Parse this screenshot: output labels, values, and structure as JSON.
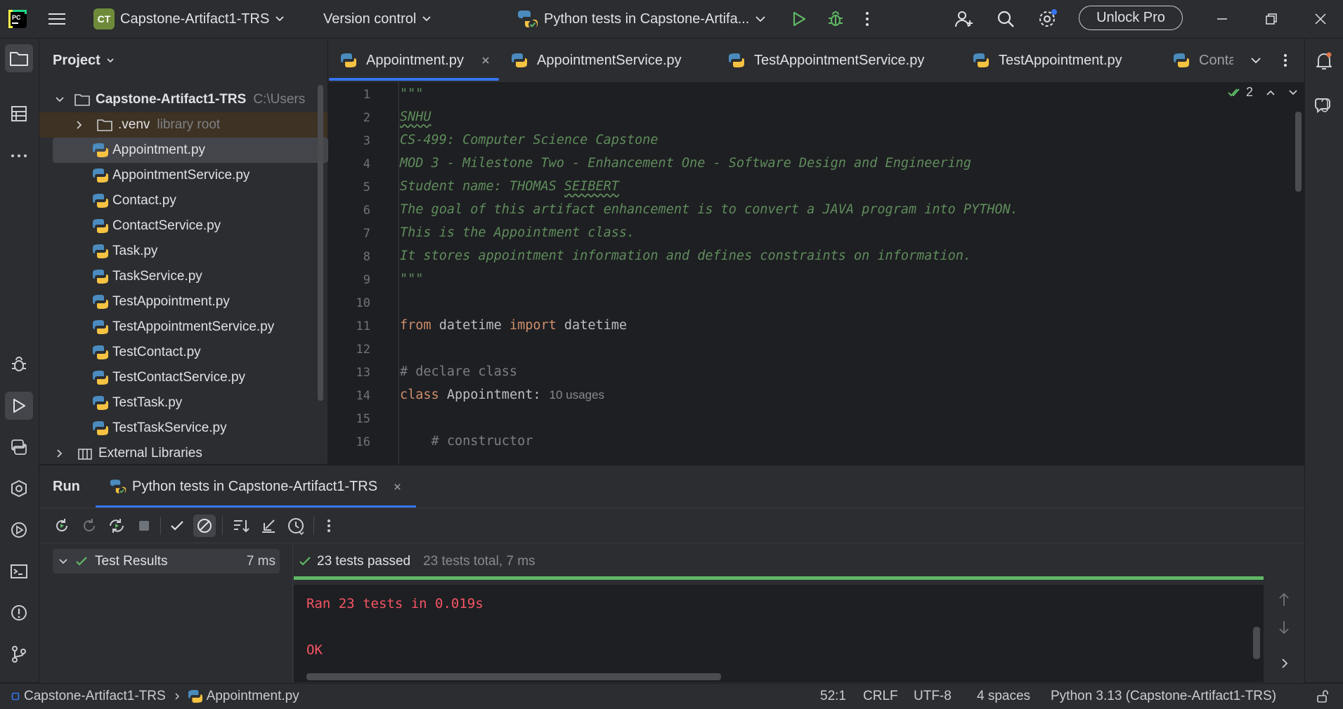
{
  "titlebar": {
    "project_badge": "CT",
    "project_name": "Capstone-Artifact1-TRS",
    "version_control": "Version control",
    "run_config": "Python tests in Capstone-Artifa...",
    "unlock_pro": "Unlock Pro"
  },
  "project_panel": {
    "title": "Project",
    "root_name": "Capstone-Artifact1-TRS",
    "root_path": "C:\\Users",
    "venv_name": ".venv",
    "venv_hint": "library root",
    "files": [
      "Appointment.py",
      "AppointmentService.py",
      "Contact.py",
      "ContactService.py",
      "Task.py",
      "TaskService.py",
      "TestAppointment.py",
      "TestAppointmentService.py",
      "TestContact.py",
      "TestContactService.py",
      "TestTask.py",
      "TestTaskService.py"
    ],
    "external_libraries": "External Libraries"
  },
  "editor_tabs": [
    "Appointment.py",
    "AppointmentService.py",
    "TestAppointmentService.py",
    "TestAppointment.py",
    "Conta"
  ],
  "editor": {
    "inspection_count": "2",
    "line_numbers": [
      "1",
      "2",
      "3",
      "4",
      "5",
      "6",
      "7",
      "8",
      "9",
      "10",
      "11",
      "12",
      "13",
      "14",
      "15",
      "16"
    ],
    "docstring_open": "\"\"\"",
    "doc_snhu": "SNHU",
    "doc_line3": "CS-499: Computer Science Capstone",
    "doc_line4": "MOD 3 - Milestone Two - Enhancement One - Software Design and Engineering",
    "doc_line5_prefix": "Student name: THOMAS ",
    "doc_line5_name": "SEIBERT",
    "doc_line6": "The goal of this artifact enhancement is to convert a JAVA program into PYTHON.",
    "doc_line7": "This is the Appointment class.",
    "doc_line8": "It stores appointment information and defines constraints on information.",
    "docstring_close": "\"\"\"",
    "kw_from": "from",
    "mod_datetime": " datetime ",
    "kw_import": "import",
    "name_datetime": " datetime",
    "comment_declare": "# declare class",
    "kw_class": "class",
    "class_decl": " Appointment:",
    "usages": "10 usages",
    "comment_constructor": "    # constructor"
  },
  "run_panel": {
    "title": "Run",
    "tab_label": "Python tests in Capstone-Artifact1-TRS",
    "test_results_label": "Test Results",
    "test_results_time": "7 ms",
    "passed_text": "23 tests passed",
    "total_text": "23 tests total, 7 ms",
    "console_line1": "Ran 23 tests in 0.019s",
    "console_line2": "OK"
  },
  "statusbar": {
    "breadcrumb_project": "Capstone-Artifact1-TRS",
    "breadcrumb_file": "Appointment.py",
    "position": "52:1",
    "line_sep": "CRLF",
    "encoding": "UTF-8",
    "indent": "4 spaces",
    "interpreter": "Python 3.13 (Capstone-Artifact1-TRS)"
  },
  "colors": {
    "accent": "#3574f0",
    "success": "#5fb865",
    "console_red": "#f75464",
    "docstring": "#5f8c5c",
    "keyword": "#cf8e6d"
  }
}
